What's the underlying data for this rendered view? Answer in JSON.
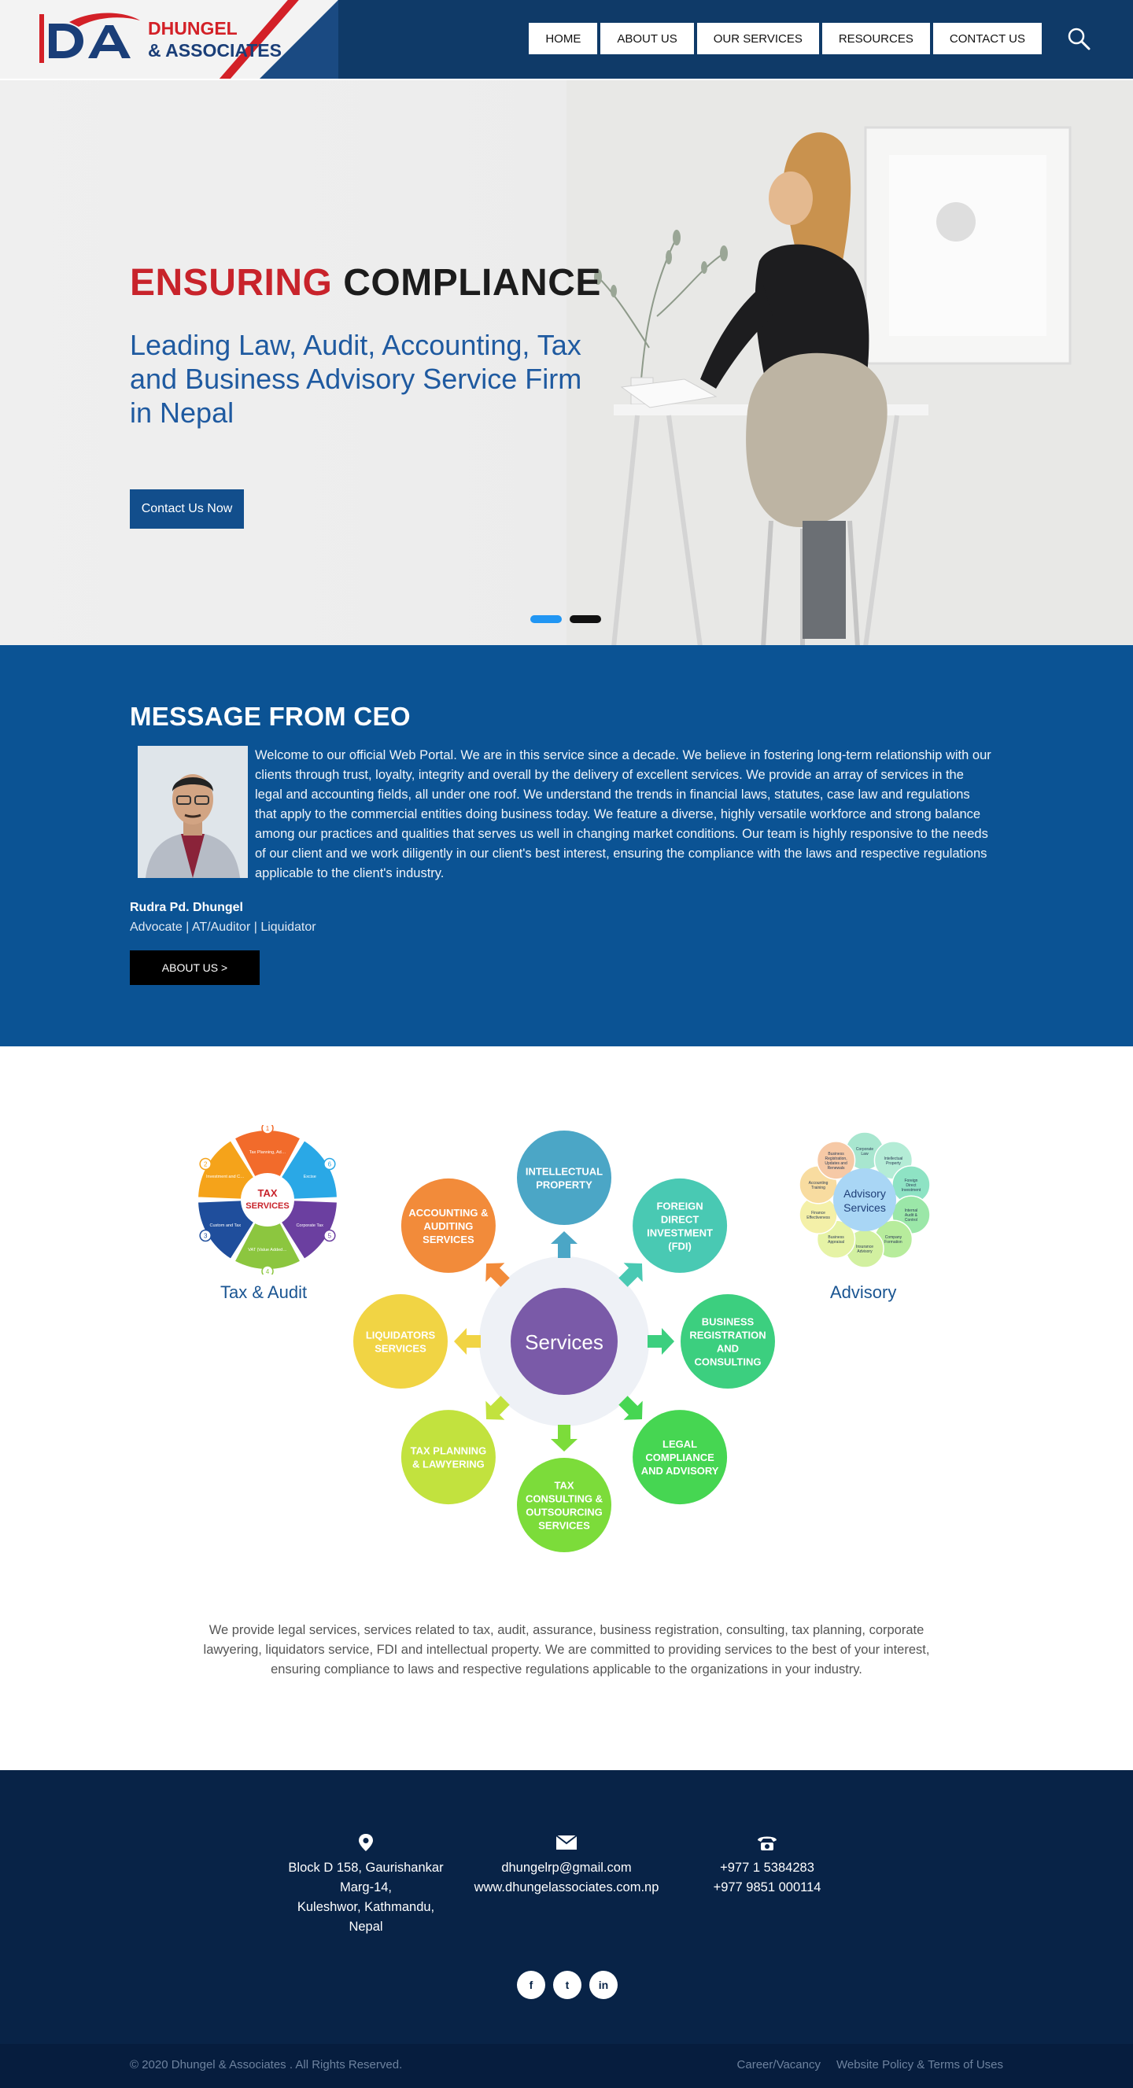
{
  "brand": {
    "name_line1": "DHUNGEL",
    "name_line2": "& ASSOCIATES",
    "mark": "DA",
    "accent": "#d32027",
    "navy": "#0f3a68"
  },
  "nav": {
    "items": [
      "HOME",
      "ABOUT US",
      "OUR SERVICES",
      "RESOURCES",
      "CONTACT US"
    ],
    "search_icon": "search-icon"
  },
  "hero": {
    "title_accent": "ENSURING",
    "title_rest": "COMPLIANCE",
    "subtitle": "Leading Law, Audit, Accounting, Tax and Business Advisory Service Firm in Nepal",
    "cta": "Contact Us Now",
    "slides": 2,
    "active_slide": 1
  },
  "ceo": {
    "heading": "MESSAGE FROM CEO",
    "message": "Welcome to our official Web Portal. We are in this service since a decade. We believe in fostering long-term relationship with our clients through trust, loyalty, integrity and overall by the delivery of excellent services. We provide an array of services in the legal and accounting fields, all under one roof. We understand the trends in financial laws, statutes, case law and regulations that apply to the commercial entities doing business today. We feature a diverse, highly versatile workforce and strong balance among our practices and qualities that serves us well in changing market conditions. Our team is highly responsive to the needs of our client and we work diligently in our client's best interest, ensuring the compliance with the laws and respective regulations applicable to the client's industry.",
    "name": "Rudra Pd. Dhungel",
    "role": "Advocate | AT/Auditor | Liquidator",
    "button": "ABOUT US >"
  },
  "services": {
    "center": "Services",
    "nodes": [
      "INTELLECTUAL PROPERTY",
      "FOREIGN DIRECT INVESTMENT (FDI)",
      "BUSINESS REGISTRATION AND CONSULTING",
      "LEGAL COMPLIANCE AND ADVISORY",
      "TAX CONSULTING & OUTSOURCING SERVICES",
      "TAX PLANNING & LAWYERING",
      "LIQUIDATORS SERVICES",
      "ACCOUNTING & AUDITING SERVICES"
    ],
    "node_colors": [
      "#4ba6c6",
      "#49c9b3",
      "#3ccf7f",
      "#46d652",
      "#7cdc3a",
      "#c2e23e",
      "#f1d444",
      "#f28b3a"
    ],
    "tax_wheel": {
      "center_top": "TAX",
      "center_bottom": "SERVICES",
      "segments": [
        "Tax Planning, Advisory, Mapping and Diversions",
        "Excise",
        "Corporate Tax",
        "VAT (Value Added Tax)",
        "Custom and Tax",
        "Investment and Commerce Services"
      ],
      "numbers": [
        "1",
        "6",
        "5",
        "4",
        "3",
        "2"
      ]
    },
    "advisory_wheel": {
      "center": "Advisory Services",
      "petals": [
        "Corporate Law",
        "Intellectual Property",
        "Foreign Direct Investment",
        "Internal Audit & Control",
        "Company Formation",
        "Insurance Advisory",
        "Business Appraisal",
        "Finance Effectiveness",
        "Accounting Training",
        "Business Registration, Updates and Renewals"
      ]
    },
    "tax_label": "Tax & Audit",
    "advisory_label": "Advisory",
    "description": "We provide legal services, services related to tax, audit, assurance, business registration, consulting, tax planning, corporate lawyering, liquidators service, FDI and intellectual property. We are committed to providing services to the best of your interest, ensuring compliance to laws and respective regulations applicable to the organizations in your industry."
  },
  "footer": {
    "address": [
      "Block D 158, Gaurishankar",
      "Marg-14,",
      "Kuleshwor, Kathmandu,",
      "Nepal"
    ],
    "email": "dhungelrp@gmail.com",
    "website": "www.dhungelassociates.com.np",
    "phones": [
      "+977 1 5384283",
      "+977 9851 000114"
    ],
    "social": [
      {
        "icon": "facebook-icon",
        "glyph": "f"
      },
      {
        "icon": "twitter-icon",
        "glyph": "t"
      },
      {
        "icon": "linkedin-icon",
        "glyph": "in"
      }
    ],
    "copyright": "© 2020 Dhungel & Associates . All Rights Reserved.",
    "links": [
      "Career/Vacancy",
      "Website Policy & Terms of Uses"
    ]
  }
}
